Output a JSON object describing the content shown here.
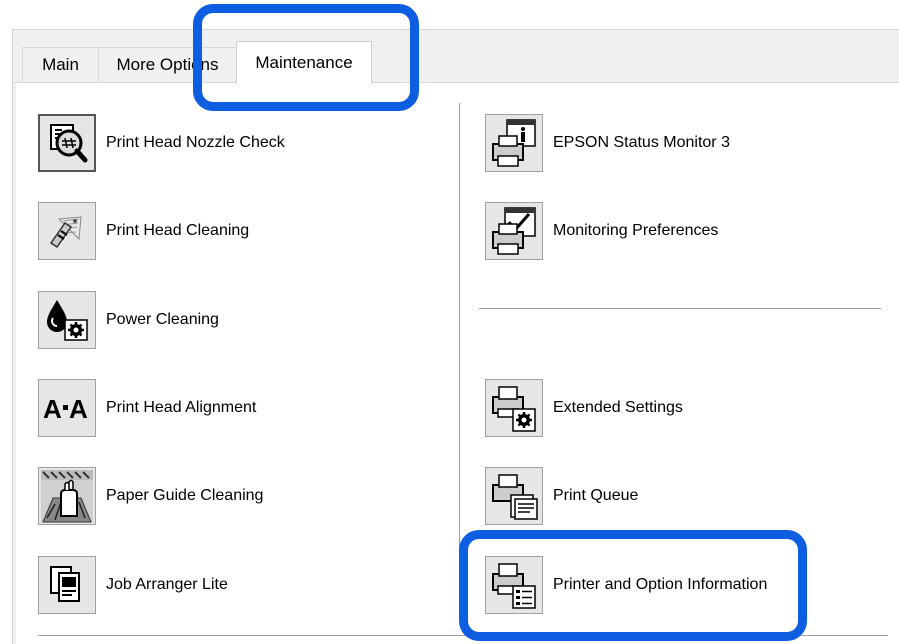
{
  "tabs": [
    {
      "label": "Main"
    },
    {
      "label": "More Options"
    },
    {
      "label": "Maintenance"
    }
  ],
  "active_tab": "Maintenance",
  "left_items": [
    {
      "label": "Print Head Nozzle Check",
      "icon": "nozzle-check-icon"
    },
    {
      "label": "Print Head Cleaning",
      "icon": "head-cleaning-icon"
    },
    {
      "label": "Power Cleaning",
      "icon": "power-cleaning-icon"
    },
    {
      "label": "Print Head Alignment",
      "icon": "head-alignment-icon"
    },
    {
      "label": "Paper Guide Cleaning",
      "icon": "paper-guide-cleaning-icon"
    },
    {
      "label": "Job Arranger Lite",
      "icon": "job-arranger-icon"
    }
  ],
  "right_items": [
    {
      "label": "EPSON Status Monitor 3",
      "icon": "status-monitor-icon"
    },
    {
      "label": "Monitoring Preferences",
      "icon": "monitoring-preferences-icon"
    },
    {
      "label": "Extended Settings",
      "icon": "extended-settings-icon"
    },
    {
      "label": "Print Queue",
      "icon": "print-queue-icon"
    },
    {
      "label": "Printer and Option Information",
      "icon": "printer-info-icon"
    }
  ],
  "colors": {
    "highlight": "#0d5ee0",
    "icon_bg": "#e6e6e6"
  }
}
